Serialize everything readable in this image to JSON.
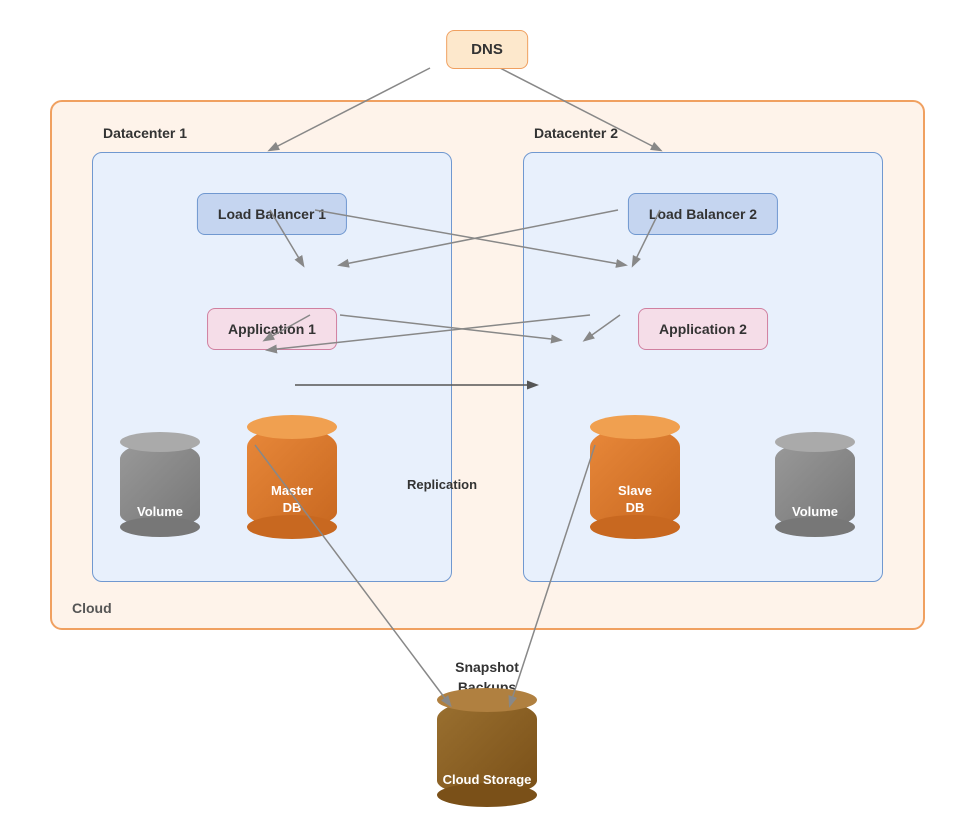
{
  "dns": {
    "label": "DNS"
  },
  "cloud": {
    "label": "Cloud"
  },
  "datacenter1": {
    "label": "Datacenter 1"
  },
  "datacenter2": {
    "label": "Datacenter 2"
  },
  "loadBalancer1": {
    "label": "Load Balancer 1"
  },
  "loadBalancer2": {
    "label": "Load Balancer 2"
  },
  "application1": {
    "label": "Application 1"
  },
  "application2": {
    "label": "Application 2"
  },
  "masterDB": {
    "label": "Master\nDB"
  },
  "slaveDB": {
    "label": "Slave\nDB"
  },
  "volume1": {
    "label": "Volume"
  },
  "volume2": {
    "label": "Volume"
  },
  "replication": {
    "label": "Replication"
  },
  "snapshotBackups": {
    "label": "Snapshot\nBackups"
  },
  "cloudStorage": {
    "label": "Cloud Storage"
  }
}
